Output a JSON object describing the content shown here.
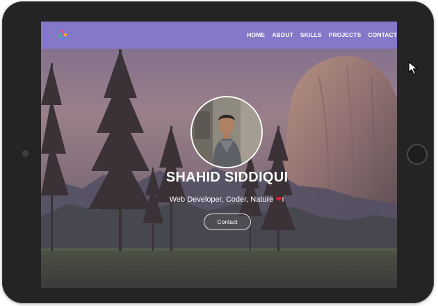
{
  "navbar": {
    "links": [
      "HOME",
      "ABOUT",
      "SKILLS",
      "PROJECTS",
      "CONTACT"
    ]
  },
  "hero": {
    "name": "SHAHID SIDDIQUI",
    "tagline_before": "Web Developer, Coder, Nature ",
    "tagline_after": "r",
    "contact_label": "Contact"
  },
  "icons": {
    "logo": "colorful-logo-icon",
    "heart": "heart-icon",
    "cursor": "mouse-cursor-icon"
  },
  "colors": {
    "navbar": "#8478ce",
    "heart": "#e11b2c",
    "device": "#242424"
  }
}
